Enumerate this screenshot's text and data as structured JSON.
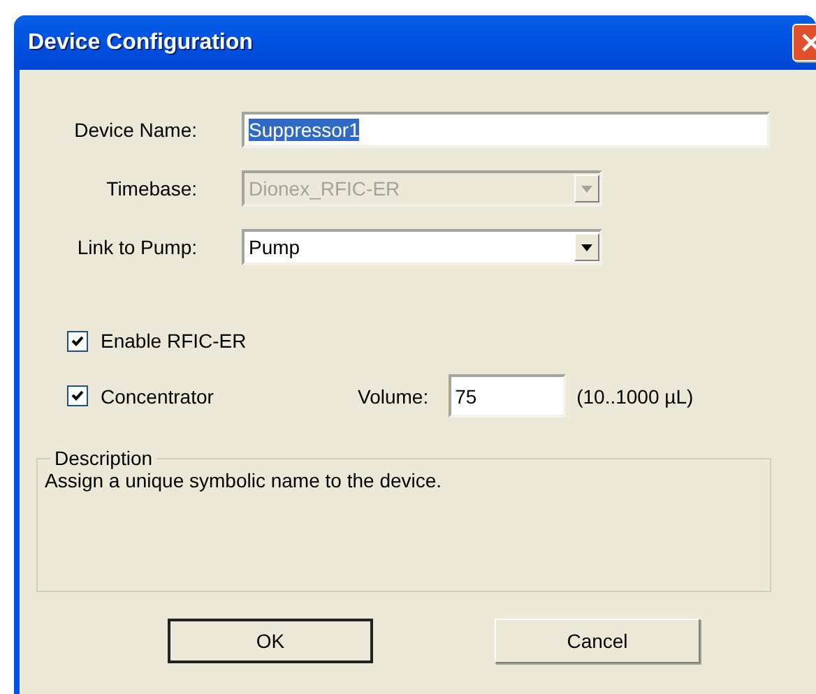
{
  "window": {
    "title": "Device Configuration"
  },
  "fields": [
    {
      "kind": "text",
      "label": "Device Name:",
      "value": "Suppressor1",
      "text_selected": true,
      "disabled": false
    },
    {
      "kind": "combo",
      "label": "Timebase:",
      "value": "Dionex_RFIC-ER",
      "disabled": true
    },
    {
      "kind": "combo",
      "label": "Link to Pump:",
      "value": "Pump",
      "disabled": false
    }
  ],
  "options": [
    {
      "label": "Enable RFIC-ER",
      "checked": true
    },
    {
      "label": "Concentrator",
      "checked": true
    }
  ],
  "volume": {
    "label": "Volume:",
    "value": "75",
    "range": "(10..1000 µL)"
  },
  "description": {
    "title": "Description",
    "text": "Assign a unique symbolic name to the device."
  },
  "buttons": [
    {
      "label": "OK",
      "default": true
    },
    {
      "label": "Cancel",
      "default": false
    }
  ]
}
